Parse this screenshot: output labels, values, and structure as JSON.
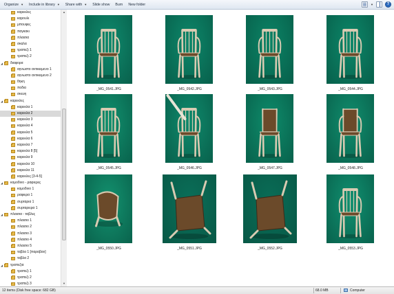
{
  "toolbar": {
    "items": [
      {
        "label": "Organize",
        "dropdown": true
      },
      {
        "label": "Include in library",
        "dropdown": true
      },
      {
        "label": "Share with",
        "dropdown": true
      },
      {
        "label": "Slide show",
        "dropdown": false
      },
      {
        "label": "Burn",
        "dropdown": false
      },
      {
        "label": "New folder",
        "dropdown": false
      }
    ]
  },
  "sidebar": {
    "items": [
      {
        "label": "καρεκλες",
        "level": 1,
        "expander": "",
        "selected": false
      },
      {
        "label": "καρουλι",
        "level": 1,
        "expander": "",
        "selected": false
      },
      {
        "label": "μπουφες",
        "level": 1,
        "expander": "",
        "selected": false
      },
      {
        "label": "παγκακι",
        "level": 1,
        "expander": "",
        "selected": false
      },
      {
        "label": "πλαισια",
        "level": 1,
        "expander": "",
        "selected": false
      },
      {
        "label": "σκαλα",
        "level": 1,
        "expander": "",
        "selected": false
      },
      {
        "label": "τραπεζι 1",
        "level": 1,
        "expander": "",
        "selected": false
      },
      {
        "label": "τραπεζι 2",
        "level": 1,
        "expander": "",
        "selected": false
      },
      {
        "label": "διαφορα",
        "level": 0,
        "expander": "◢",
        "selected": false
      },
      {
        "label": "αγνωστο αντικειμενο 1",
        "level": 1,
        "expander": "",
        "selected": false
      },
      {
        "label": "αγνωστο αντικειμενο 2",
        "level": 1,
        "expander": "",
        "selected": false
      },
      {
        "label": "θηκη",
        "level": 1,
        "expander": "",
        "selected": false
      },
      {
        "label": "ποδια",
        "level": 1,
        "expander": "",
        "selected": false
      },
      {
        "label": "σκευη",
        "level": 1,
        "expander": "",
        "selected": false
      },
      {
        "label": "καρεκλες",
        "level": 0,
        "expander": "◢",
        "selected": false
      },
      {
        "label": "καρεκλα 1",
        "level": 1,
        "expander": "",
        "selected": false
      },
      {
        "label": "καρεκλα 2",
        "level": 1,
        "expander": "",
        "selected": true
      },
      {
        "label": "καρεκλα 3",
        "level": 1,
        "expander": "",
        "selected": false
      },
      {
        "label": "καρεκλα 4",
        "level": 1,
        "expander": "",
        "selected": false
      },
      {
        "label": "καρεκλα 5",
        "level": 1,
        "expander": "",
        "selected": false
      },
      {
        "label": "καρεκλα 6",
        "level": 1,
        "expander": "",
        "selected": false
      },
      {
        "label": "καρεκλα 7",
        "level": 1,
        "expander": "",
        "selected": false
      },
      {
        "label": "καρεκλα 8 [5]",
        "level": 1,
        "expander": "",
        "selected": false
      },
      {
        "label": "καρεκλα 9",
        "level": 1,
        "expander": "",
        "selected": false
      },
      {
        "label": "καρεκλα 10",
        "level": 1,
        "expander": "",
        "selected": false
      },
      {
        "label": "καρεκλα 11",
        "level": 1,
        "expander": "",
        "selected": false
      },
      {
        "label": "καρεκλες [3-4-5]",
        "level": 1,
        "expander": "",
        "selected": false
      },
      {
        "label": "κομοδινο - ραφιερες",
        "level": 0,
        "expander": "◢",
        "selected": false
      },
      {
        "label": "κομοδινο 1",
        "level": 1,
        "expander": "",
        "selected": false
      },
      {
        "label": "ραφιερα 1",
        "level": 1,
        "expander": "",
        "selected": false
      },
      {
        "label": "συρταρια 1",
        "level": 1,
        "expander": "",
        "selected": false
      },
      {
        "label": "συρταριερα 1",
        "level": 1,
        "expander": "",
        "selected": false
      },
      {
        "label": "πλαισια - ταβλες",
        "level": 0,
        "expander": "◢",
        "selected": false
      },
      {
        "label": "πλαισιο 1",
        "level": 1,
        "expander": "",
        "selected": false
      },
      {
        "label": "πλαισιο 2",
        "level": 1,
        "expander": "",
        "selected": false
      },
      {
        "label": "πλαισιο 3",
        "level": 1,
        "expander": "",
        "selected": false
      },
      {
        "label": "πλαισιο 4",
        "level": 1,
        "expander": "",
        "selected": false
      },
      {
        "label": "πλαισιο 5",
        "level": 1,
        "expander": "",
        "selected": false
      },
      {
        "label": "ταβλα 1 [παραβαν]",
        "level": 1,
        "expander": "",
        "selected": false
      },
      {
        "label": "ταβλα 2",
        "level": 1,
        "expander": "",
        "selected": false
      },
      {
        "label": "τραπεζια",
        "level": 0,
        "expander": "◢",
        "selected": false
      },
      {
        "label": "τραπεζι 1",
        "level": 1,
        "expander": "",
        "selected": false
      },
      {
        "label": "τραπεζι 2",
        "level": 1,
        "expander": "",
        "selected": false
      },
      {
        "label": "τραπεζι 3",
        "level": 1,
        "expander": "",
        "selected": false
      }
    ]
  },
  "files": [
    {
      "name": "_MG_0541.JPG",
      "bg": "#0f8a6d",
      "pose": "front-left"
    },
    {
      "name": "_MG_0542.JPG",
      "bg": "#0d876a",
      "pose": "front"
    },
    {
      "name": "_MG_0543.JPG",
      "bg": "#0b8466",
      "pose": "side-right"
    },
    {
      "name": "_MG_0544.JPG",
      "bg": "#0c8769",
      "pose": "side"
    },
    {
      "name": "_MG_0545.JPG",
      "bg": "#11906e",
      "pose": "side"
    },
    {
      "name": "_MG_0546.JPG",
      "bg": "#0f8a6c",
      "pose": "hand"
    },
    {
      "name": "_MG_0547.JPG",
      "bg": "#0e8c6b",
      "pose": "back"
    },
    {
      "name": "_MG_0548.JPG",
      "bg": "#108d6d",
      "pose": "back-side"
    },
    {
      "name": "_MG_0550.JPG",
      "bg": "#13926f",
      "pose": "tipped"
    },
    {
      "name": "_MG_0551.JPG",
      "bg": "#0b6f59",
      "pose": "under"
    },
    {
      "name": "_MG_0552.JPG",
      "bg": "#0a6d57",
      "pose": "under"
    },
    {
      "name": "_MG_0553.JPG",
      "bg": "#109070",
      "pose": "front-left"
    }
  ],
  "status": {
    "items_text": "12 items (Disk free space: 682 GB)",
    "size_text": "68.0 MB",
    "location_text": "Computer"
  }
}
